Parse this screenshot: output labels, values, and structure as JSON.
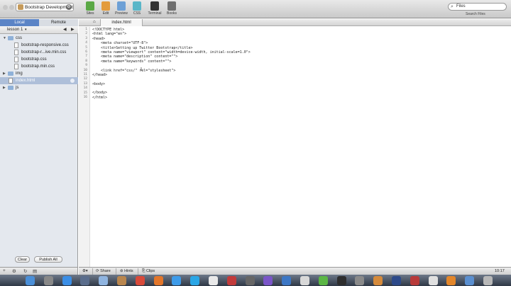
{
  "toolbar": {
    "site_name": "Bootstrap Development",
    "tools": [
      {
        "label": "Sites",
        "icon": "sites-icon",
        "color": "#5aa845"
      },
      {
        "label": "Edit",
        "icon": "edit-pencil-icon",
        "color": "#e39b3c"
      },
      {
        "label": "Preview",
        "icon": "preview-magnifier-icon",
        "color": "#6da0d6"
      },
      {
        "label": "CSS",
        "icon": "css-palette-icon",
        "color": "#59b6c8"
      },
      {
        "label": "Terminal",
        "icon": "terminal-icon",
        "color": "#333333"
      },
      {
        "label": "Books",
        "icon": "books-icon",
        "color": "#6f6f6f"
      }
    ],
    "search_placeholder": "Files",
    "search_label": "Search Files"
  },
  "sidebar": {
    "tabs": {
      "local": "Local",
      "remote": "Remote"
    },
    "lesson": "lesson 1",
    "tree": [
      {
        "label": "css",
        "type": "folder",
        "indent": 0,
        "open": true
      },
      {
        "label": "bootstrap-responsive.css",
        "type": "file",
        "indent": 1
      },
      {
        "label": "bootstrap-r...ive.min.css",
        "type": "file",
        "indent": 1
      },
      {
        "label": "bootstrap.css",
        "type": "file",
        "indent": 1
      },
      {
        "label": "bootstrap.min.css",
        "type": "file",
        "indent": 1
      },
      {
        "label": "img",
        "type": "folder",
        "indent": 0,
        "open": false
      },
      {
        "label": "index.html",
        "type": "file",
        "indent": 0,
        "selected": true
      },
      {
        "label": "js",
        "type": "folder",
        "indent": 0,
        "open": false
      }
    ],
    "clear_label": "Clear",
    "publish_label": "Publish All"
  },
  "editor": {
    "filename": "index.html",
    "lines": [
      "<!DOCTYPE html>",
      "<html lang=\"en\">",
      "<head>",
      "    <meta charset=\"UTF-8\">",
      "    <title>Setting up Twitter Bootstrap</title>",
      "    <meta name=\"viewport\" content=\"width=device-width, initial-scale=1.0\">",
      "    <meta name=\"description\" content=\"\">",
      "    <meta name=\"keywords\" content=\"\">",
      "",
      "    <link href=\"css/\" rel=\"stylesheet\">",
      "</head>",
      "",
      "<body>",
      "",
      "</body>",
      "</html>"
    ]
  },
  "statusbar": {
    "share_label": "Share",
    "hints_label": "Hints",
    "clips_label": "Clips",
    "position": "10:17"
  },
  "dock": {
    "apps": [
      {
        "icon": "finder-icon",
        "color": "#4a8fd8"
      },
      {
        "icon": "launchpad-icon",
        "color": "#888888"
      },
      {
        "icon": "app-store-icon",
        "color": "#3a8ee6"
      },
      {
        "icon": "mission-control-icon",
        "color": "#5a6d8c"
      },
      {
        "icon": "mail-icon",
        "color": "#8fb4e0"
      },
      {
        "icon": "contacts-icon",
        "color": "#b9864e"
      },
      {
        "icon": "chrome-icon",
        "color": "#d94a3a"
      },
      {
        "icon": "firefox-icon",
        "color": "#e3762a"
      },
      {
        "icon": "safari-icon",
        "color": "#3d9be9"
      },
      {
        "icon": "skype-icon",
        "color": "#2aa6e6"
      },
      {
        "icon": "calendar-icon",
        "color": "#e9e9e9"
      },
      {
        "icon": "photos-icon",
        "color": "#c23b3b"
      },
      {
        "icon": "activity-monitor-icon",
        "color": "#666666"
      },
      {
        "icon": "itunes-icon",
        "color": "#7a55c8"
      },
      {
        "icon": "xcode-icon",
        "color": "#3c77c5"
      },
      {
        "icon": "coda-icon",
        "color": "#d8d8d8"
      },
      {
        "icon": "evernote-icon",
        "color": "#5bb645"
      },
      {
        "icon": "terminal-app-icon",
        "color": "#2e2e2e"
      },
      {
        "icon": "system-preferences-icon",
        "color": "#8a8a8a"
      },
      {
        "icon": "sequel-pro-icon",
        "color": "#d58a3b"
      },
      {
        "icon": "photoshop-icon",
        "color": "#2d4a8a"
      },
      {
        "icon": "filezilla-icon",
        "color": "#b83a3a"
      },
      {
        "icon": "textedit-icon",
        "color": "#e0e0e0"
      },
      {
        "icon": "vlc-icon",
        "color": "#e3862a"
      },
      {
        "icon": "downloads-folder-icon",
        "color": "#5a8fd0"
      },
      {
        "icon": "trash-icon",
        "color": "#b8b8b8"
      }
    ]
  }
}
